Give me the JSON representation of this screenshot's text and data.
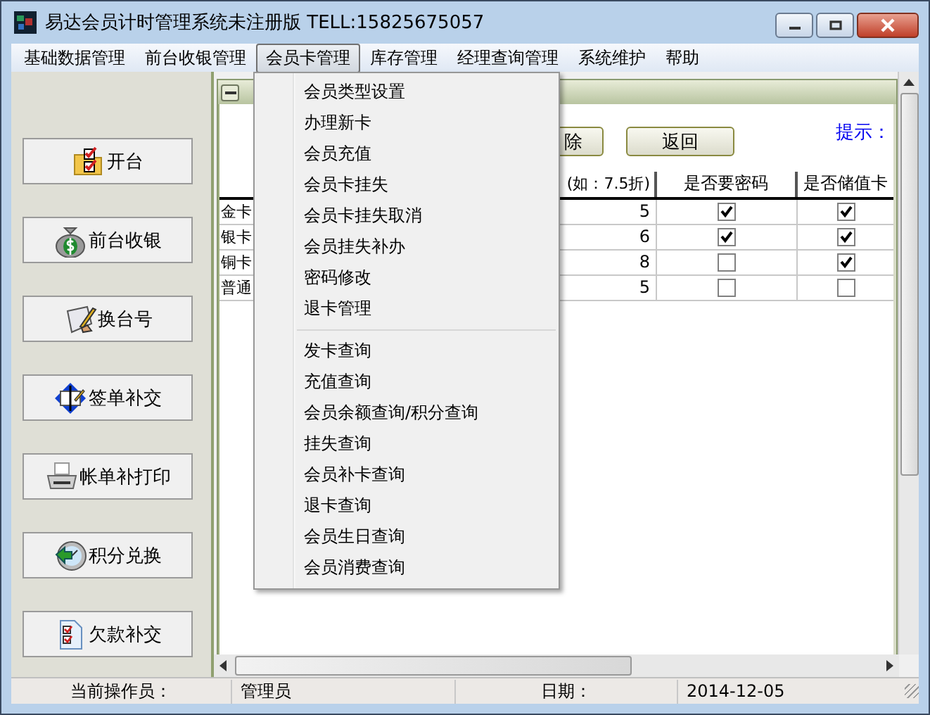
{
  "window": {
    "title": "易达会员计时管理系统未注册版 TELL:15825675057"
  },
  "menu_bar": [
    {
      "label": "基础数据管理",
      "selected": false
    },
    {
      "label": "前台收银管理",
      "selected": false
    },
    {
      "label": "会员卡管理",
      "selected": true
    },
    {
      "label": "库存管理",
      "selected": false
    },
    {
      "label": "经理查询管理",
      "selected": false
    },
    {
      "label": "系统维护",
      "selected": false
    },
    {
      "label": "帮助",
      "selected": false
    }
  ],
  "dropdown": {
    "sections": [
      [
        "会员类型设置",
        "办理新卡",
        "会员充值",
        "会员卡挂失",
        "会员卡挂失取消",
        "会员挂失补办",
        "密码修改",
        "退卡管理"
      ],
      [
        "发卡查询",
        "充值查询",
        "会员余额查询/积分查询",
        "挂失查询",
        "会员补卡查询",
        "退卡查询",
        "会员生日查询",
        "会员消费查询"
      ]
    ]
  },
  "sidebar": {
    "buttons": [
      {
        "label": "开台",
        "kind": "folder"
      },
      {
        "label": "前台收银",
        "kind": "moneybag"
      },
      {
        "label": "换台号",
        "kind": "scroll"
      },
      {
        "label": "签单补交",
        "kind": "diamond"
      },
      {
        "label": "帐单补打印",
        "kind": "printer"
      },
      {
        "label": "积分兑换",
        "kind": "clock"
      },
      {
        "label": "欠款补交",
        "kind": "document"
      }
    ]
  },
  "child_window": {
    "buttons": [
      "除",
      "返回"
    ],
    "hint": "提示：",
    "table": {
      "columns": [
        "(如：7.5折)",
        "是否要密码",
        "是否储值卡"
      ],
      "rows": [
        {
          "name": "金卡",
          "discount": "5",
          "password": true,
          "stored_value": true
        },
        {
          "name": "银卡",
          "discount": "6",
          "password": true,
          "stored_value": true
        },
        {
          "name": "铜卡",
          "discount": "8",
          "password": false,
          "stored_value": true
        },
        {
          "name": "普通",
          "discount": "5",
          "password": false,
          "stored_value": false
        }
      ]
    }
  },
  "status_bar": [
    {
      "label": "当前操作员："
    },
    {
      "label": "管理员"
    },
    {
      "label": "日期："
    },
    {
      "label": "2014-12-05"
    }
  ]
}
